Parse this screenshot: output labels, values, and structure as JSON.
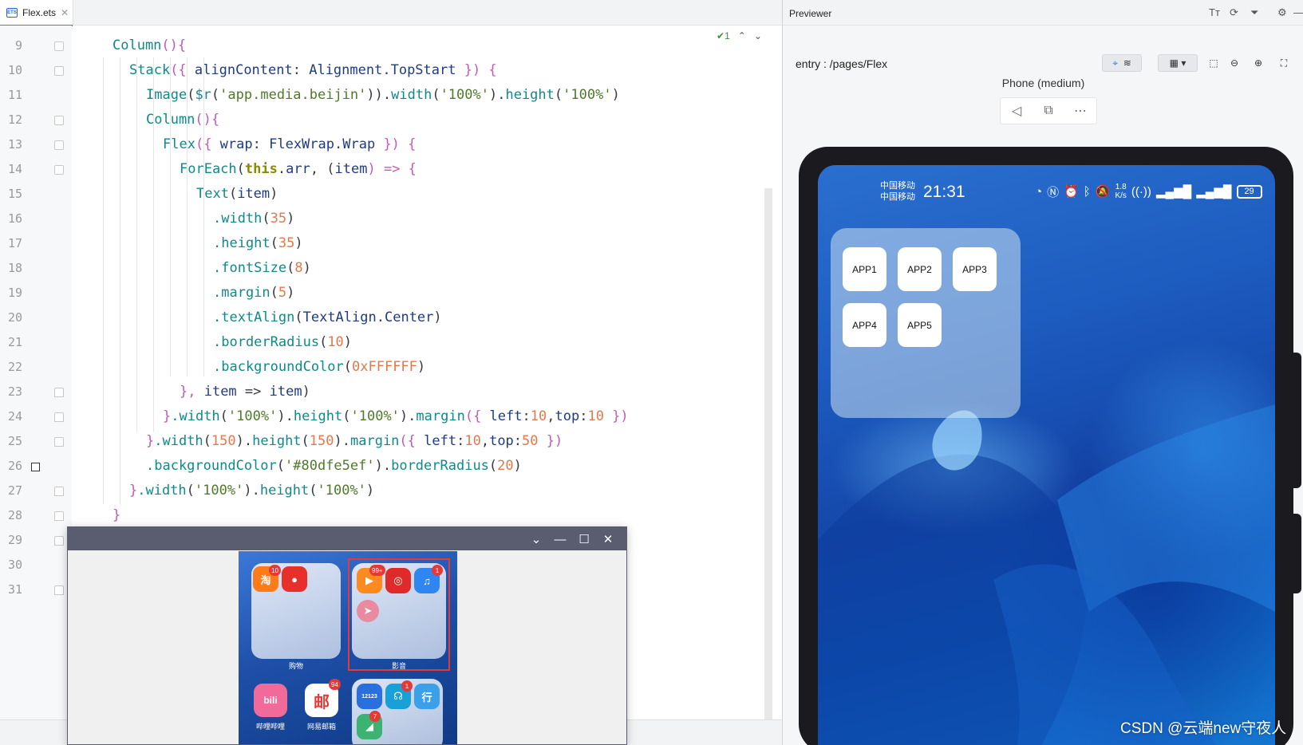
{
  "editor": {
    "tab_label": "Flex.ets",
    "inspection_count": "1",
    "lines": [
      {
        "n": "9"
      },
      {
        "n": "10"
      },
      {
        "n": "11"
      },
      {
        "n": "12"
      },
      {
        "n": "13"
      },
      {
        "n": "14"
      },
      {
        "n": "15"
      },
      {
        "n": "16"
      },
      {
        "n": "17"
      },
      {
        "n": "18"
      },
      {
        "n": "19"
      },
      {
        "n": "20"
      },
      {
        "n": "21"
      },
      {
        "n": "22"
      },
      {
        "n": "23"
      },
      {
        "n": "24"
      },
      {
        "n": "25"
      },
      {
        "n": "26"
      },
      {
        "n": "27"
      },
      {
        "n": "28"
      },
      {
        "n": "29"
      },
      {
        "n": "30"
      },
      {
        "n": "31"
      }
    ],
    "code": [
      [
        {
          "t": "Column",
          "c": "fn"
        },
        {
          "t": "(){",
          "c": "br"
        }
      ],
      [
        {
          "t": "Stack",
          "c": "fn"
        },
        {
          "t": "({ ",
          "c": "br"
        },
        {
          "t": "alignContent",
          "c": "id"
        },
        {
          "t": ": ",
          "c": "pl"
        },
        {
          "t": "Alignment",
          "c": "id"
        },
        {
          "t": ".",
          "c": "pl"
        },
        {
          "t": "TopStart",
          "c": "id"
        },
        {
          "t": " }) {",
          "c": "br"
        }
      ],
      [
        {
          "t": "Image",
          "c": "fn"
        },
        {
          "t": "(",
          "c": "pl"
        },
        {
          "t": "$r",
          "c": "fn"
        },
        {
          "t": "(",
          "c": "pl"
        },
        {
          "t": "'app.media.beijin'",
          "c": "str"
        },
        {
          "t": ")).",
          "c": "pl"
        },
        {
          "t": "width",
          "c": "prop"
        },
        {
          "t": "(",
          "c": "pl"
        },
        {
          "t": "'100%'",
          "c": "str"
        },
        {
          "t": ").",
          "c": "pl"
        },
        {
          "t": "height",
          "c": "prop"
        },
        {
          "t": "(",
          "c": "pl"
        },
        {
          "t": "'100%'",
          "c": "str"
        },
        {
          "t": ")",
          "c": "pl"
        }
      ],
      [
        {
          "t": "Column",
          "c": "fn"
        },
        {
          "t": "(){",
          "c": "br"
        }
      ],
      [
        {
          "t": "Flex",
          "c": "fn"
        },
        {
          "t": "({ ",
          "c": "br"
        },
        {
          "t": "wrap",
          "c": "id"
        },
        {
          "t": ": ",
          "c": "pl"
        },
        {
          "t": "FlexWrap",
          "c": "id"
        },
        {
          "t": ".",
          "c": "pl"
        },
        {
          "t": "Wrap",
          "c": "id"
        },
        {
          "t": " }) {",
          "c": "br"
        }
      ],
      [
        {
          "t": "ForEach",
          "c": "fn"
        },
        {
          "t": "(",
          "c": "pl"
        },
        {
          "t": "this",
          "c": "kw"
        },
        {
          "t": ".",
          "c": "pl"
        },
        {
          "t": "arr",
          "c": "id"
        },
        {
          "t": ", (",
          "c": "pl"
        },
        {
          "t": "item",
          "c": "id"
        },
        {
          "t": ") => {",
          "c": "br"
        }
      ],
      [
        {
          "t": "Text",
          "c": "fn"
        },
        {
          "t": "(",
          "c": "pl"
        },
        {
          "t": "item",
          "c": "id"
        },
        {
          "t": ")",
          "c": "pl"
        }
      ],
      [
        {
          "t": ".width",
          "c": "prop"
        },
        {
          "t": "(",
          "c": "pl"
        },
        {
          "t": "35",
          "c": "num"
        },
        {
          "t": ")",
          "c": "pl"
        }
      ],
      [
        {
          "t": ".height",
          "c": "prop"
        },
        {
          "t": "(",
          "c": "pl"
        },
        {
          "t": "35",
          "c": "num"
        },
        {
          "t": ")",
          "c": "pl"
        }
      ],
      [
        {
          "t": ".fontSize",
          "c": "prop"
        },
        {
          "t": "(",
          "c": "pl"
        },
        {
          "t": "8",
          "c": "num"
        },
        {
          "t": ")",
          "c": "pl"
        }
      ],
      [
        {
          "t": ".margin",
          "c": "prop"
        },
        {
          "t": "(",
          "c": "pl"
        },
        {
          "t": "5",
          "c": "num"
        },
        {
          "t": ")",
          "c": "pl"
        }
      ],
      [
        {
          "t": ".textAlign",
          "c": "prop"
        },
        {
          "t": "(",
          "c": "pl"
        },
        {
          "t": "TextAlign",
          "c": "id"
        },
        {
          "t": ".",
          "c": "pl"
        },
        {
          "t": "Center",
          "c": "id"
        },
        {
          "t": ")",
          "c": "pl"
        }
      ],
      [
        {
          "t": ".borderRadius",
          "c": "prop"
        },
        {
          "t": "(",
          "c": "pl"
        },
        {
          "t": "10",
          "c": "num"
        },
        {
          "t": ")",
          "c": "pl"
        }
      ],
      [
        {
          "t": ".backgroundColor",
          "c": "prop"
        },
        {
          "t": "(",
          "c": "pl"
        },
        {
          "t": "0xFFFFFF",
          "c": "num"
        },
        {
          "t": ")",
          "c": "pl"
        }
      ],
      [
        {
          "t": "}, ",
          "c": "br"
        },
        {
          "t": "item",
          "c": "id"
        },
        {
          "t": " => ",
          "c": "pl"
        },
        {
          "t": "item",
          "c": "id"
        },
        {
          "t": ")",
          "c": "pl"
        }
      ],
      [
        {
          "t": "}",
          "c": "br"
        },
        {
          "t": ".width",
          "c": "prop"
        },
        {
          "t": "(",
          "c": "pl"
        },
        {
          "t": "'100%'",
          "c": "str"
        },
        {
          "t": ").",
          "c": "pl"
        },
        {
          "t": "height",
          "c": "prop"
        },
        {
          "t": "(",
          "c": "pl"
        },
        {
          "t": "'100%'",
          "c": "str"
        },
        {
          "t": ").",
          "c": "pl"
        },
        {
          "t": "margin",
          "c": "prop"
        },
        {
          "t": "({ ",
          "c": "br"
        },
        {
          "t": "left",
          "c": "id"
        },
        {
          "t": ":",
          "c": "pl"
        },
        {
          "t": "10",
          "c": "num"
        },
        {
          "t": ",",
          "c": "pl"
        },
        {
          "t": "top",
          "c": "id"
        },
        {
          "t": ":",
          "c": "pl"
        },
        {
          "t": "10",
          "c": "num"
        },
        {
          "t": " })",
          "c": "br"
        }
      ],
      [
        {
          "t": "}",
          "c": "br"
        },
        {
          "t": ".width",
          "c": "prop"
        },
        {
          "t": "(",
          "c": "pl"
        },
        {
          "t": "150",
          "c": "num"
        },
        {
          "t": ").",
          "c": "pl"
        },
        {
          "t": "height",
          "c": "prop"
        },
        {
          "t": "(",
          "c": "pl"
        },
        {
          "t": "150",
          "c": "num"
        },
        {
          "t": ").",
          "c": "pl"
        },
        {
          "t": "margin",
          "c": "prop"
        },
        {
          "t": "({ ",
          "c": "br"
        },
        {
          "t": "left",
          "c": "id"
        },
        {
          "t": ":",
          "c": "pl"
        },
        {
          "t": "10",
          "c": "num"
        },
        {
          "t": ",",
          "c": "pl"
        },
        {
          "t": "top",
          "c": "id"
        },
        {
          "t": ":",
          "c": "pl"
        },
        {
          "t": "50",
          "c": "num"
        },
        {
          "t": " })",
          "c": "br"
        }
      ],
      [
        {
          "t": ".backgroundColor",
          "c": "prop"
        },
        {
          "t": "(",
          "c": "pl"
        },
        {
          "t": "'#80dfe5ef'",
          "c": "str"
        },
        {
          "t": ").",
          "c": "pl"
        },
        {
          "t": "borderRadius",
          "c": "prop"
        },
        {
          "t": "(",
          "c": "pl"
        },
        {
          "t": "20",
          "c": "num"
        },
        {
          "t": ")",
          "c": "pl"
        }
      ],
      [
        {
          "t": "}",
          "c": "br"
        },
        {
          "t": ".width",
          "c": "prop"
        },
        {
          "t": "(",
          "c": "pl"
        },
        {
          "t": "'100%'",
          "c": "str"
        },
        {
          "t": ").",
          "c": "pl"
        },
        {
          "t": "height",
          "c": "prop"
        },
        {
          "t": "(",
          "c": "pl"
        },
        {
          "t": "'100%'",
          "c": "str"
        },
        {
          "t": ")",
          "c": "pl"
        }
      ],
      [
        {
          "t": "}",
          "c": "br"
        }
      ],
      [],
      [],
      []
    ]
  },
  "floating_window": {
    "folder_shopping_label": "购物",
    "folder_media_label": "影音",
    "badges": {
      "taobao": "10",
      "youku": "99+",
      "music": "1",
      "mail": "94",
      "radio": "1",
      "maps": "7"
    },
    "app_labels": {
      "bilibili": "哔哩哔哩",
      "mail": "网易邮箱"
    },
    "app_glyphs": {
      "taobao": "淘",
      "bilibili": "bili",
      "mail": "邮",
      "traffic": "12123",
      "travel": "行"
    }
  },
  "previewer": {
    "title": "Previewer",
    "entry_path": "entry : /pages/Flex",
    "device_name": "Phone (medium)",
    "status": {
      "carrier_1": "中国移动",
      "carrier_2": "中国移动",
      "time": "21:31",
      "net_speed_value": "1.8",
      "net_speed_unit": "K/s",
      "battery": "29"
    },
    "apps": [
      "APP1",
      "APP2",
      "APP3",
      "APP4",
      "APP5"
    ]
  },
  "watermark": "CSDN @云端new守夜人",
  "colors": {
    "panel_bg": "#80dfe5ef",
    "accent": "#3d7dd6",
    "window_titlebar": "#5a5d70"
  }
}
